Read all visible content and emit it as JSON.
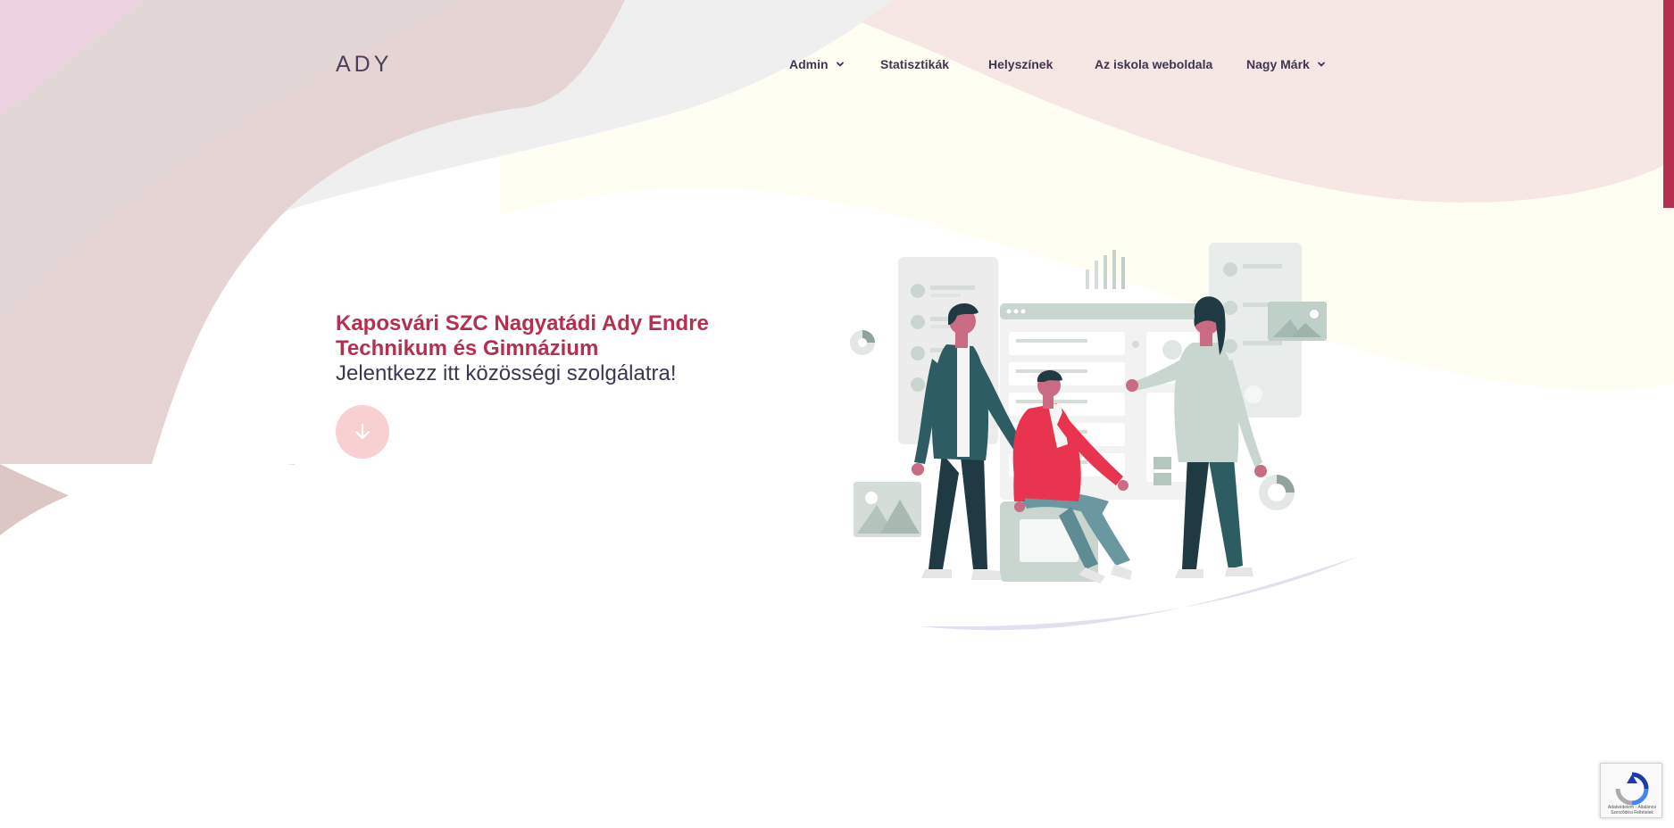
{
  "brand": {
    "logo": "ADY"
  },
  "nav": {
    "items": [
      {
        "label": "Admin",
        "has_dropdown": true
      },
      {
        "label": "Statisztikák",
        "has_dropdown": false
      },
      {
        "label": "Helyszínek",
        "has_dropdown": false
      },
      {
        "label": "Az iskola weboldala",
        "has_dropdown": false
      },
      {
        "label": "Nagy Márk",
        "has_dropdown": true
      }
    ]
  },
  "hero": {
    "title_line1": "Kaposvári SZC Nagyatádi Ady Endre",
    "title_line2": "Technikum és Gimnázium",
    "subtitle": "Jelentkezz itt közösségi szolgálatra!",
    "scroll_icon": "arrow-down-icon"
  },
  "recaptcha": {
    "text": "Adatvédelem - Általános Szerződési Feltételek",
    "icon": "recaptcha-icon"
  },
  "colors": {
    "accent": "#b5304f",
    "text": "#3e3651",
    "button": "#f8d0d2",
    "pink_blob": "#e7d2d3",
    "light_pink": "#f5e5e5",
    "cream": "#fffdf0",
    "shirt_red": "#e8344e",
    "teal_dark": "#1f3a43",
    "teal": "#2d5d62"
  }
}
